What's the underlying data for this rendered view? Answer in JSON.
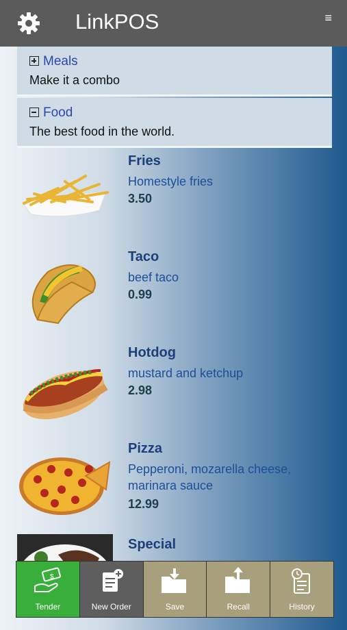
{
  "header": {
    "title": "LinkPOS",
    "settings_icon": "gear-icon",
    "menu_icon": "hamburger-icon",
    "menu_glyph": "≡"
  },
  "categories": [
    {
      "name": "Meals",
      "description": "Make it a combo",
      "state": "collapsed"
    },
    {
      "name": "Food",
      "description": "The best food in the world.",
      "state": "expanded"
    }
  ],
  "items": [
    {
      "name": "Fries",
      "description": "Homestyle fries",
      "price": "3.50"
    },
    {
      "name": "Taco",
      "description": "beef taco",
      "price": "0.99"
    },
    {
      "name": "Hotdog",
      "description": "mustard and ketchup",
      "price": "2.98"
    },
    {
      "name": "Pizza",
      "description": "Pepperoni, mozarella cheese, marinara sauce",
      "price": "12.99"
    },
    {
      "name": "Special",
      "description": "",
      "price": ""
    }
  ],
  "toolbar": {
    "tender": "Tender",
    "new_order": "New Order",
    "save": "Save",
    "recall": "Recall",
    "history": "History"
  },
  "colors": {
    "header_bg": "#5b5b5b",
    "tender_bg": "#3aae3a",
    "new_order_bg": "#5e5e5e",
    "action_bg": "#a89f7c",
    "category_link": "#2c47b0"
  }
}
